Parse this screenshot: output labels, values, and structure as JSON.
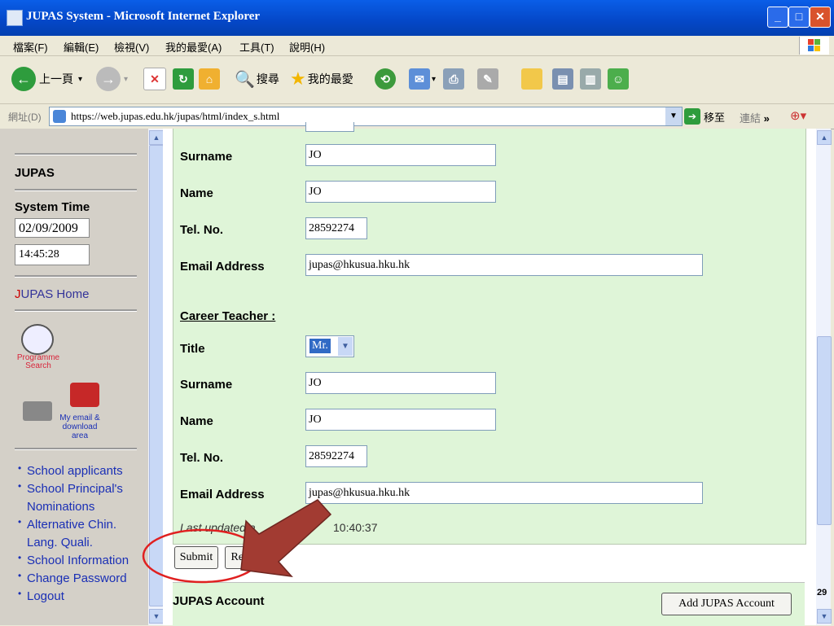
{
  "window": {
    "title": "JUPAS System - Microsoft Internet Explorer"
  },
  "menu": [
    "檔案(F)",
    "編輯(E)",
    "檢視(V)",
    "我的最愛(A)",
    "工具(T)",
    "說明(H)"
  ],
  "toolbar": {
    "back": "上一頁",
    "search": "搜尋",
    "favorites": "我的最愛"
  },
  "address": {
    "label": "網址(D)",
    "url": "https://web.jupas.edu.hk/jupas/html/index_s.html",
    "go": "移至",
    "links": "連結"
  },
  "sidebar": {
    "heading": "JUPAS",
    "system_time_label": "System Time",
    "date": "02/09/2009",
    "time": "14:45:28",
    "home_j": "J",
    "home_rest": "UPAS Home",
    "programme_search": "Programme Search",
    "email_download": "My email & download area",
    "links": [
      "School applicants",
      "School Principal's Nominations",
      "Alternative Chin. Lang. Quali.",
      "School Information",
      "Change Password",
      "Logout"
    ]
  },
  "form": {
    "principal": {
      "surname_label": "Surname",
      "surname": "JO",
      "name_label": "Name",
      "name": "JO",
      "tel_label": "Tel. No.",
      "tel": "28592274",
      "email_label": "Email Address",
      "email": "jupas@hkusua.hku.hk"
    },
    "career_heading": "Career Teacher :",
    "career": {
      "title_label": "Title",
      "title": "Mr.",
      "surname_label": "Surname",
      "surname": "JO",
      "name_label": "Name",
      "name": "JO",
      "tel_label": "Tel. No.",
      "tel": "28592274",
      "email_label": "Email Address",
      "email": "jupas@hkusua.hku.hk"
    },
    "last_updated_label": "Last updated a",
    "last_updated_time": "10:40:37",
    "submit": "Submit",
    "reset": "Reset"
  },
  "account": {
    "heading": "JUPAS Account",
    "add_button": "Add JUPAS Account"
  },
  "page_number": "29",
  "colors": {
    "panel": "#dff5d8",
    "annotation": "#a23b32",
    "highlight_ring": "#e02020"
  }
}
